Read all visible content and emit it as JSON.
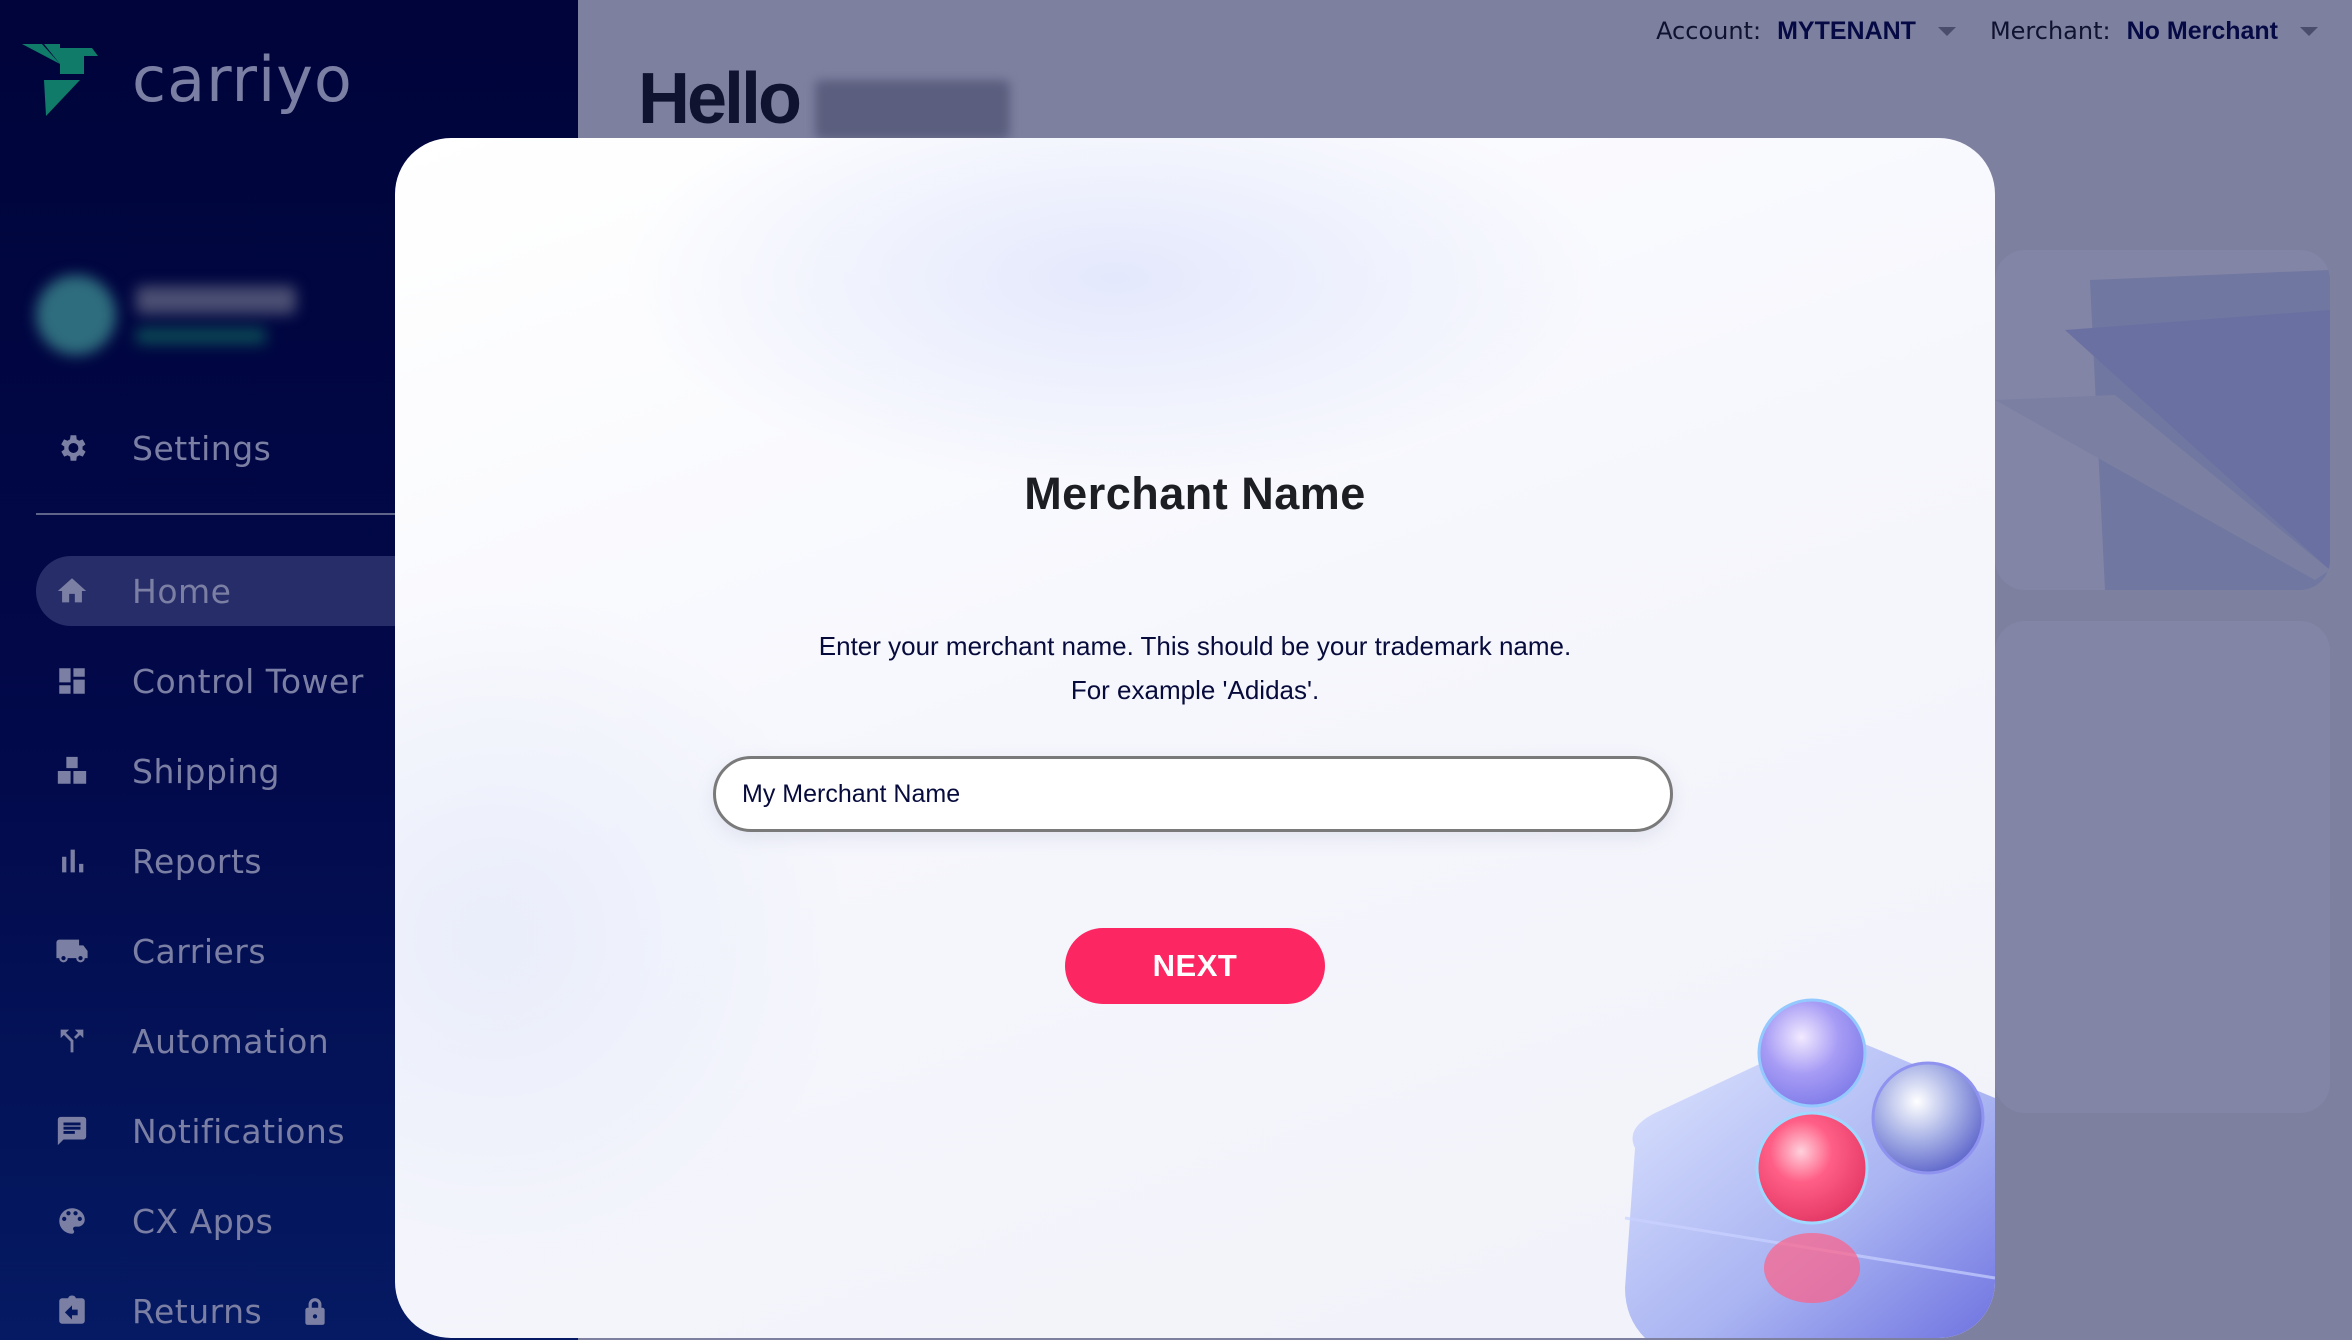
{
  "brand": {
    "name": "carriyo",
    "logo_color": "#0f7b68"
  },
  "sidebar": {
    "user": {
      "name": "[blurred]",
      "role": "[blurred]"
    },
    "settings": {
      "label": "Settings",
      "icon": "gear-icon"
    },
    "items": [
      {
        "label": "Home",
        "icon": "home-icon",
        "active": true
      },
      {
        "label": "Control Tower",
        "icon": "dashboard-icon"
      },
      {
        "label": "Shipping",
        "icon": "boxes-icon"
      },
      {
        "label": "Reports",
        "icon": "bar-chart-icon"
      },
      {
        "label": "Carriers",
        "icon": "truck-icon"
      },
      {
        "label": "Automation",
        "icon": "fork-arrows-icon"
      },
      {
        "label": "Notifications",
        "icon": "chat-icon"
      },
      {
        "label": "CX Apps",
        "icon": "palette-icon"
      },
      {
        "label": "Returns",
        "icon": "return-icon",
        "locked": true
      }
    ]
  },
  "header": {
    "greeting": "Hello",
    "account_label": "Account:",
    "account_value": "MYTENANT",
    "merchant_label": "Merchant:",
    "merchant_value": "No Merchant"
  },
  "modal": {
    "title": "Merchant Name",
    "description_line1": "Enter your merchant name. This should be your trademark name.",
    "description_line2": "For example 'Adidas'.",
    "input_value": "My Merchant Name",
    "next_label": "NEXT"
  },
  "colors": {
    "sidebar_bg": "#00043a",
    "accent_pink": "#fc2662",
    "overlay": "#7e80a0",
    "text_dark": "#070b3c"
  }
}
